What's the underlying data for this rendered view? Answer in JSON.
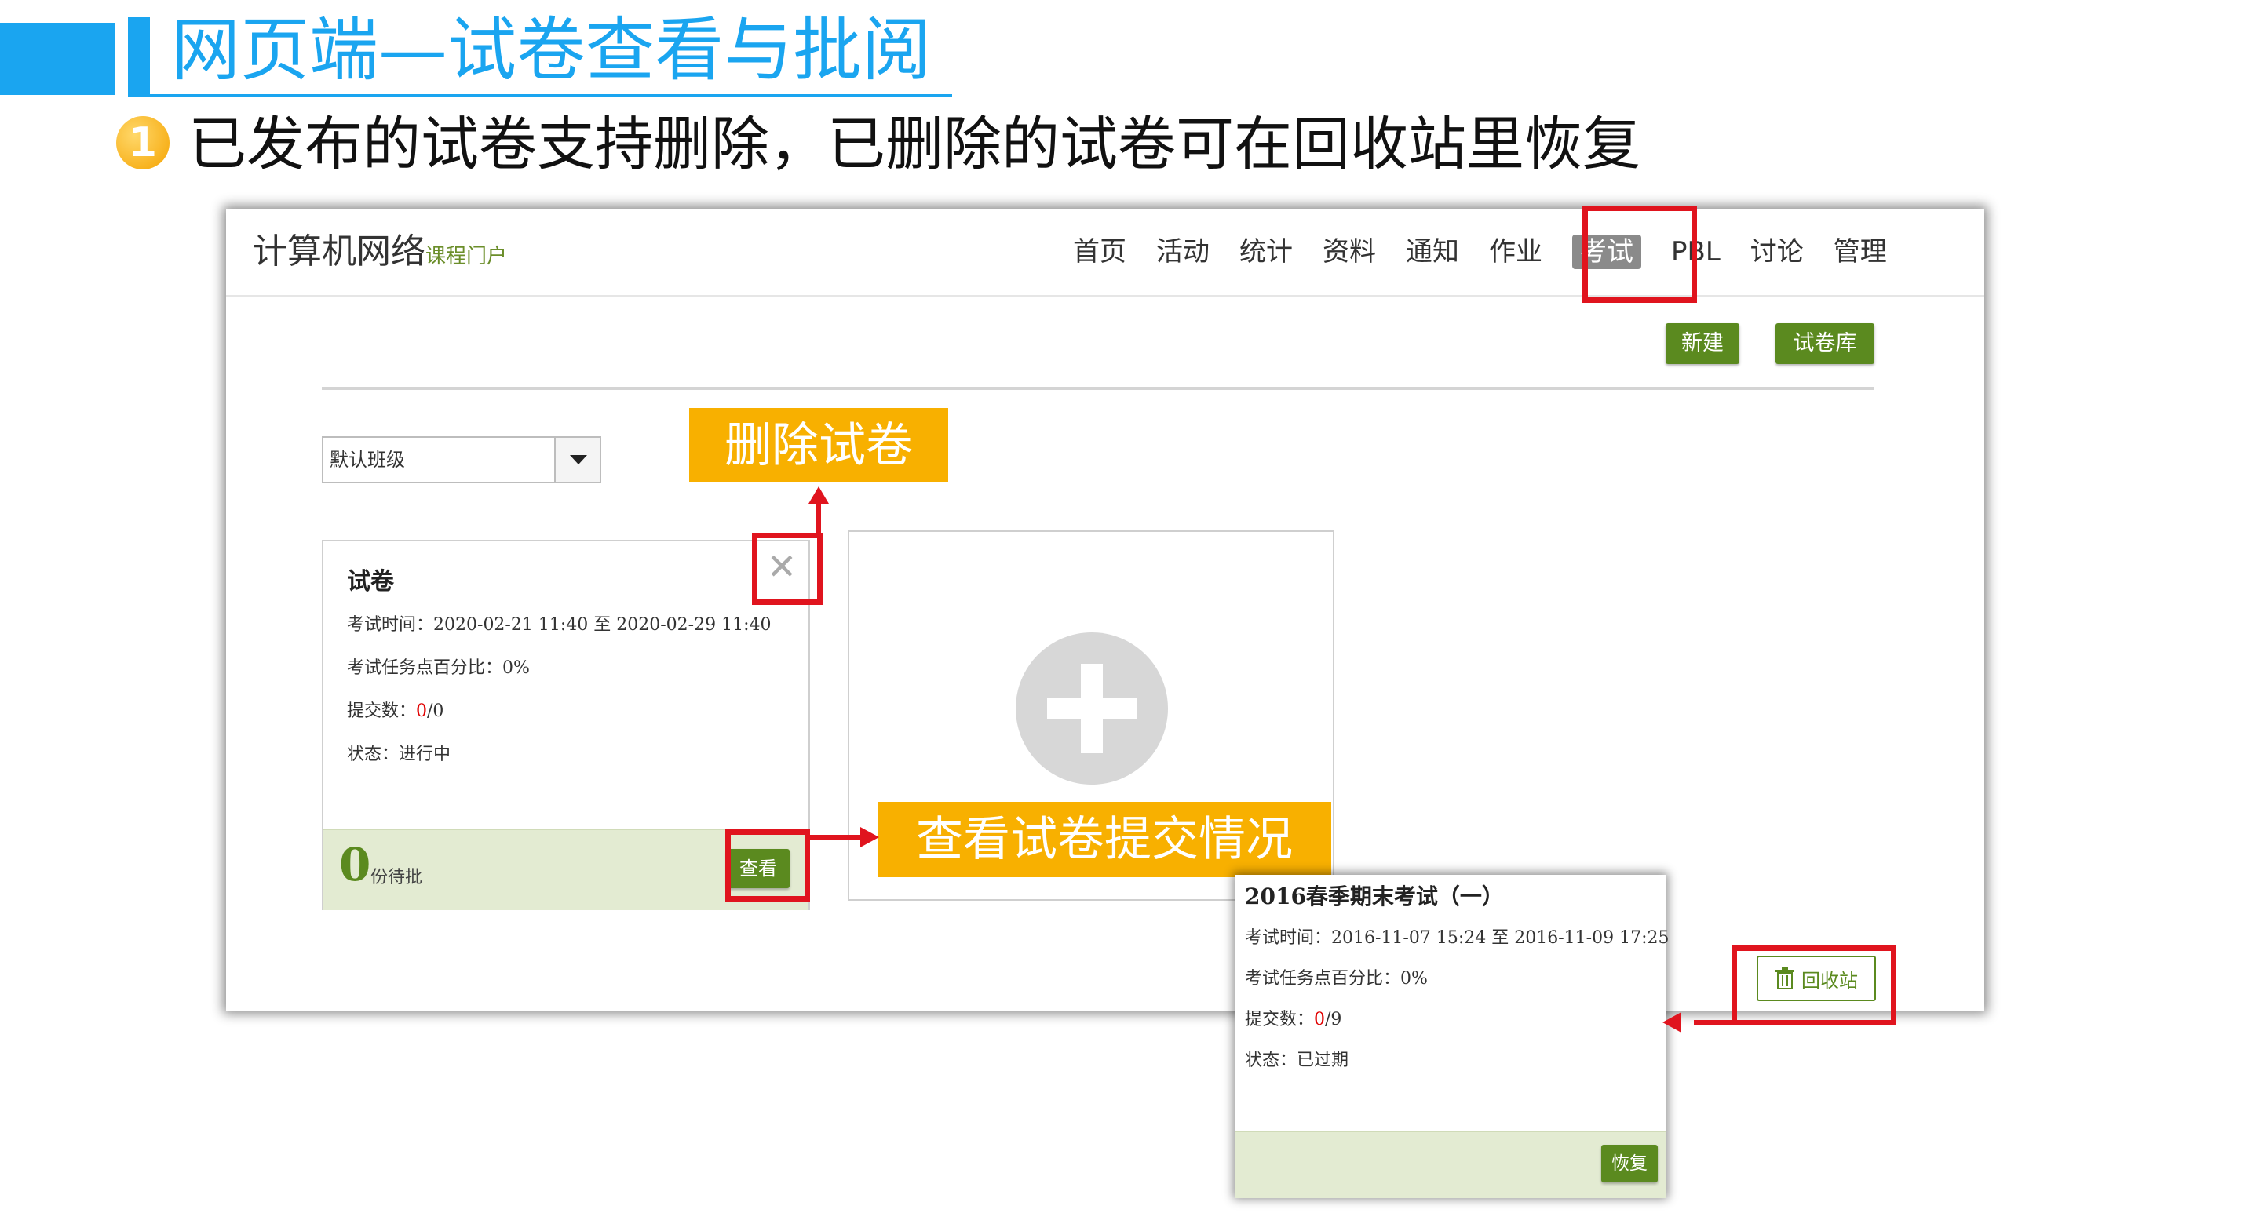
{
  "slide": {
    "title": "网页端—试卷查看与批阅",
    "bullet_number": "1",
    "bullet_text": "已发布的试卷支持删除，已删除的试卷可在回收站里恢复"
  },
  "app": {
    "logo": "计算机网络",
    "logo_sub": "课程门户",
    "nav": [
      "首页",
      "活动",
      "统计",
      "资料",
      "通知",
      "作业",
      "考试",
      "PBL",
      "讨论",
      "管理"
    ],
    "active_nav": "考试",
    "new_button": "新建",
    "library_button": "试卷库",
    "class_select": "默认班级",
    "recycle_button": "回收站"
  },
  "exam_card": {
    "title": "试卷",
    "time_label": "考试时间：",
    "time_value": "2020-02-21 11:40 至 2020-02-29 11:40",
    "percent_label": "考试任务点百分比：",
    "percent_value": "0%",
    "submit_label": "提交数：",
    "submit_done": "0",
    "submit_total": "/0",
    "status_label": "状态：",
    "status_value": "进行中",
    "pending_count": "0",
    "pending_label": "份待批",
    "view_button": "查看",
    "close_glyph": "✕"
  },
  "deleted_card": {
    "title": "2016春季期末考试（一）",
    "time_label": "考试时间：",
    "time_value": "2016-11-07 15:24 至 2016-11-09 17:25",
    "percent_label": "考试任务点百分比：",
    "percent_value": "0%",
    "submit_label": "提交数：",
    "submit_done": "0",
    "submit_total": "/9",
    "status_label": "状态：",
    "status_value": "已过期",
    "restore_button": "恢复"
  },
  "annotations": {
    "delete_callout": "删除试卷",
    "view_callout": "查看试卷提交情况"
  },
  "colors": {
    "accent_blue": "#1aa5f0",
    "green": "#5b8a1f",
    "callout_orange": "#f8b000",
    "highlight_red": "#e0141e"
  }
}
